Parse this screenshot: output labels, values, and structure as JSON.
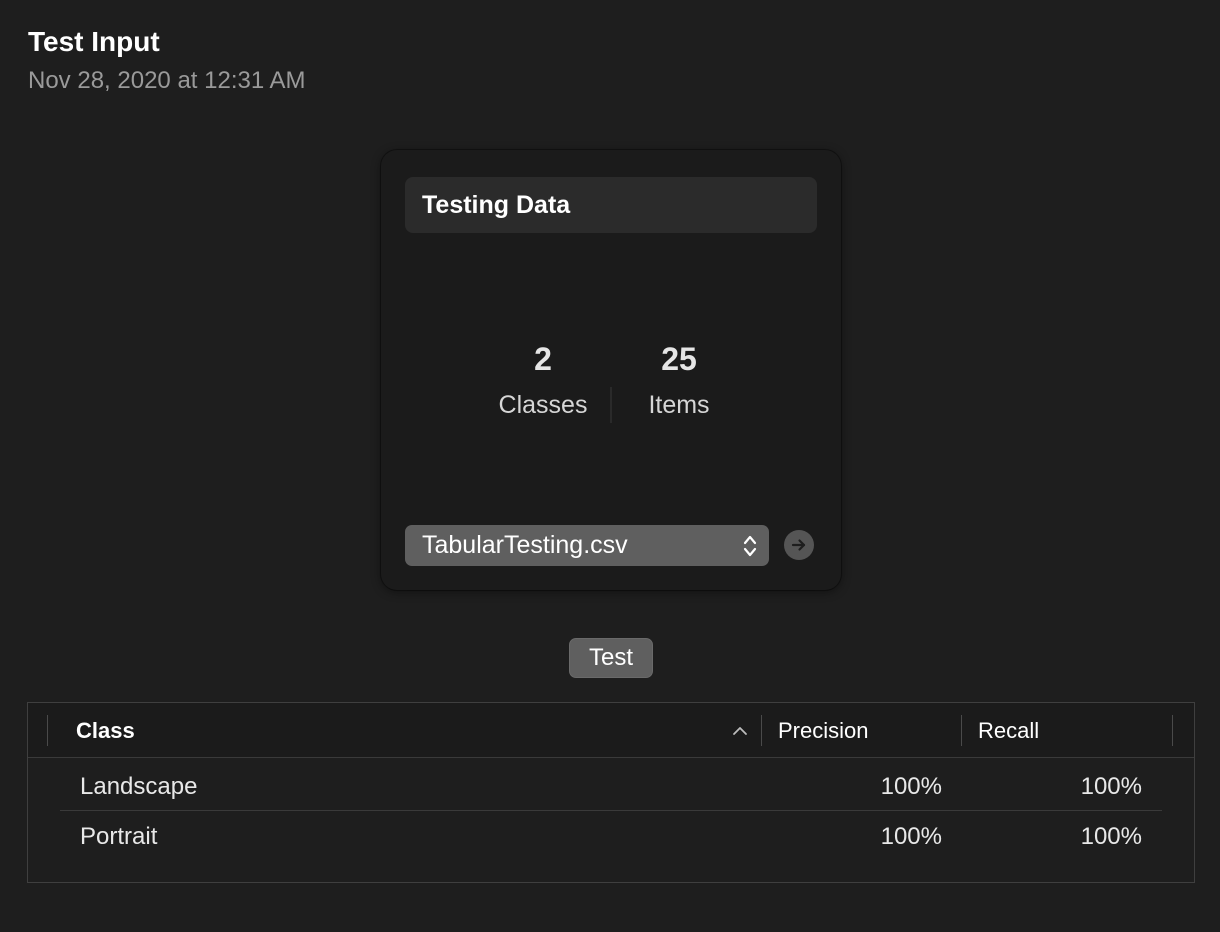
{
  "header": {
    "title": "Test Input",
    "timestamp": "Nov 28, 2020 at 12:31 AM"
  },
  "card": {
    "title": "Testing Data",
    "stats": [
      {
        "value": "2",
        "label": "Classes"
      },
      {
        "value": "25",
        "label": "Items"
      }
    ],
    "file_select": {
      "selected": "TabularTesting.csv",
      "icon": "chevron-up-down-icon"
    },
    "go_icon": "arrow-right-circle-icon"
  },
  "test_button": {
    "label": "Test"
  },
  "table": {
    "columns": [
      "Class",
      "Precision",
      "Recall"
    ],
    "sort": {
      "column": "Class",
      "direction": "ascending",
      "icon": "chevron-up-icon"
    },
    "rows": [
      {
        "class": "Landscape",
        "precision": "100%",
        "recall": "100%"
      },
      {
        "class": "Portrait",
        "precision": "100%",
        "recall": "100%"
      }
    ]
  },
  "colors": {
    "background": "#1e1e1e",
    "card_background": "#1b1b1b",
    "control_background": "#5f5f5f",
    "secondary_text": "#9a9a9a"
  }
}
